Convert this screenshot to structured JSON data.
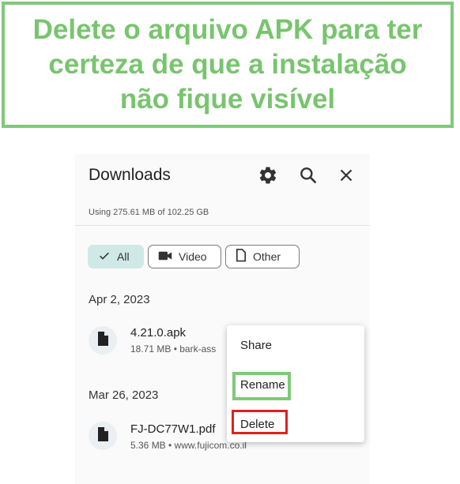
{
  "banner": {
    "line1": "Delete o arquivo APK para ter",
    "line2": "certeza de que a instalação",
    "line3": "não fique visível"
  },
  "header": {
    "title": "Downloads",
    "storage": "Using 275.61 MB of 102.25 GB",
    "icons": [
      "gear-icon",
      "search-icon",
      "close-icon"
    ]
  },
  "filters": [
    {
      "label": "All",
      "icon": "check-icon",
      "selected": true
    },
    {
      "label": "Video",
      "icon": "video-icon",
      "selected": false
    },
    {
      "label": "Other",
      "icon": "file-icon",
      "selected": false
    }
  ],
  "groups": [
    {
      "date": "Apr 2, 2023",
      "file": {
        "name": "4.21.0.apk",
        "meta": "18.71 MB • bark-ass"
      }
    },
    {
      "date": "Mar 26, 2023",
      "file": {
        "name": "FJ-DC77W1.pdf",
        "meta": "5.36 MB • www.fujicom.co.il"
      }
    }
  ],
  "context_menu": {
    "share": "Share",
    "rename": "Rename",
    "delete": "Delete"
  },
  "colors": {
    "highlight_green": "#7fc97a",
    "highlight_red": "#e02020",
    "chip_selected": "#cfe9e6"
  }
}
